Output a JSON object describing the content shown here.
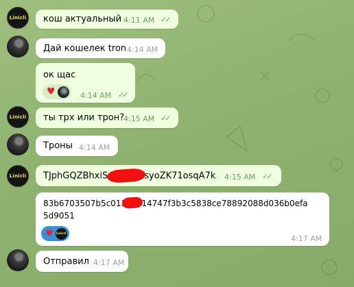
{
  "avatars": {
    "logo_text": "Linicli"
  },
  "messages": [
    {
      "id": "m1",
      "text": "кош актуальный",
      "time": "4:11 AM",
      "outgoing": true,
      "read": true
    },
    {
      "id": "m2",
      "text": "Дай кошелек tron",
      "time": "4:14 AM",
      "outgoing": false
    },
    {
      "id": "m3",
      "text": "ок щас",
      "time": "4:14 AM",
      "outgoing": true,
      "read": true,
      "reaction": "heart"
    },
    {
      "id": "m4",
      "text": "ты трх или трон?",
      "time": "4:15 AM",
      "outgoing": true,
      "read": true
    },
    {
      "id": "m5",
      "text": "Троны",
      "time": "4:14 AM",
      "outgoing": false
    },
    {
      "id": "m6",
      "text_start": "TJphGQZBhxiS4",
      "text_end": "dsyoZK71osqA7k",
      "time": "4:15 AM",
      "outgoing": true,
      "read": true
    },
    {
      "id": "m7",
      "text_line1_start": "83b6703507b5c013",
      "text_line1_end": "e14747f3b3c5838ce78892088d036b0efa",
      "text_line2": "5d9051",
      "time": "4:17 AM",
      "outgoing": false,
      "reaction": "heart"
    },
    {
      "id": "m8",
      "text": "Отправил",
      "time": "4:17 AM",
      "outgoing": false
    }
  ],
  "colors": {
    "outgoing_bubble": "#eefedf",
    "incoming_bubble": "#ffffff",
    "read_check": "#5fb35a",
    "redaction": "#f11010"
  }
}
